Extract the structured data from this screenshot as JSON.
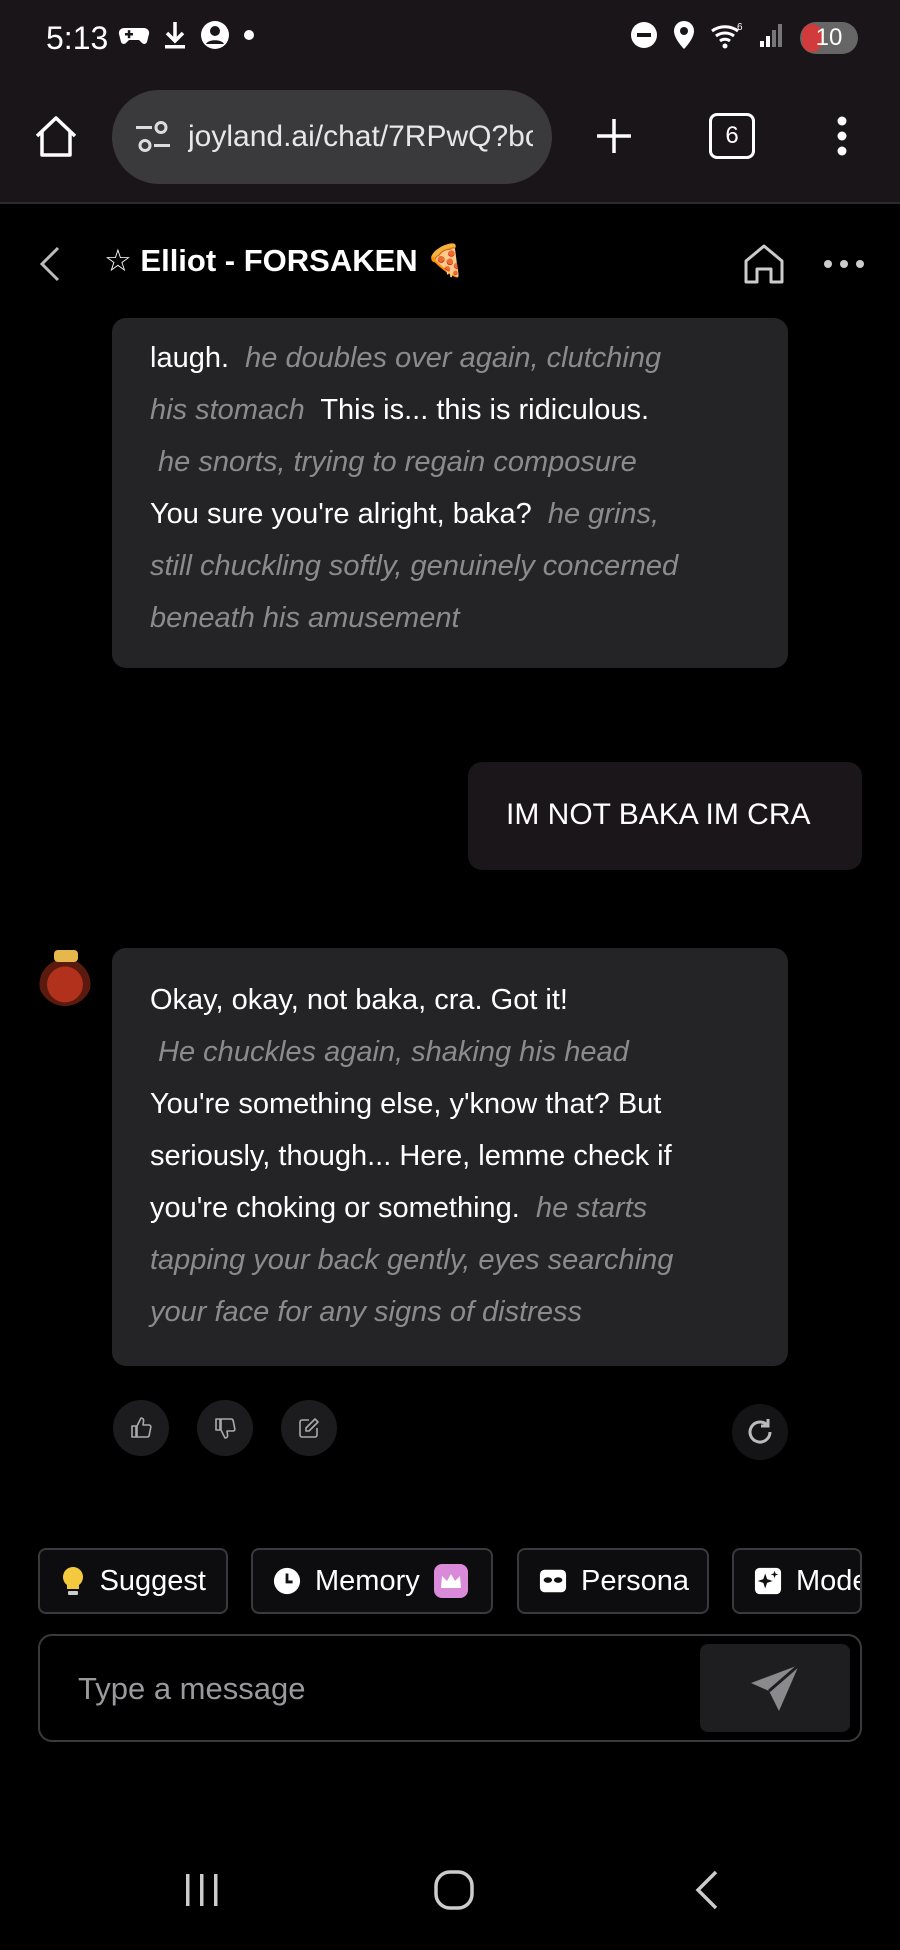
{
  "status_bar": {
    "time": "5:13",
    "battery": "10",
    "wifi_label": "6"
  },
  "browser": {
    "url": "joyland.ai/chat/7RPwQ?bc",
    "tab_count": "6"
  },
  "chat_header": {
    "title": "☆ Elliot - FORSAKEN 🍕"
  },
  "messages": {
    "bot_1": {
      "lines": [
        [
          {
            "t": "laugh. ",
            "a": false
          },
          {
            "t": " he doubles over again, clutching",
            "a": true
          }
        ],
        [
          {
            "t": "his stomach ",
            "a": true
          },
          {
            "t": " This is... this is ridiculous.",
            "a": false
          }
        ],
        [
          {
            "t": " he snorts, trying to regain composure",
            "a": true
          }
        ],
        [
          {
            "t": "You sure you're alright, baka? ",
            "a": false
          },
          {
            "t": " he grins,",
            "a": true
          }
        ],
        [
          {
            "t": "still chuckling softly, genuinely concerned",
            "a": true
          }
        ],
        [
          {
            "t": "beneath his amusement",
            "a": true
          }
        ]
      ]
    },
    "user_1": {
      "text": "IM NOT BAKA IM CRA"
    },
    "bot_2": {
      "lines": [
        [
          {
            "t": "Okay, okay, not baka, cra. Got it!",
            "a": false
          }
        ],
        [
          {
            "t": " He chuckles again, shaking his head",
            "a": true
          }
        ],
        [
          {
            "t": "You're something else, y'know that? But",
            "a": false
          }
        ],
        [
          {
            "t": "seriously, though... Here, lemme check if",
            "a": false
          }
        ],
        [
          {
            "t": "you're choking or something. ",
            "a": false
          },
          {
            "t": " he starts",
            "a": true
          }
        ],
        [
          {
            "t": "tapping your back gently, eyes searching",
            "a": true
          }
        ],
        [
          {
            "t": "your face for any signs of distress",
            "a": true
          }
        ]
      ]
    }
  },
  "chips": {
    "suggest": "Suggest",
    "memory": "Memory",
    "persona": "Persona",
    "model": "Model"
  },
  "composer": {
    "placeholder": "Type a message"
  },
  "colors": {
    "bubble": "#242427",
    "action_text": "#8b8b8f",
    "chrome": "#1a1519",
    "memory_badge": "#d98ad8"
  }
}
